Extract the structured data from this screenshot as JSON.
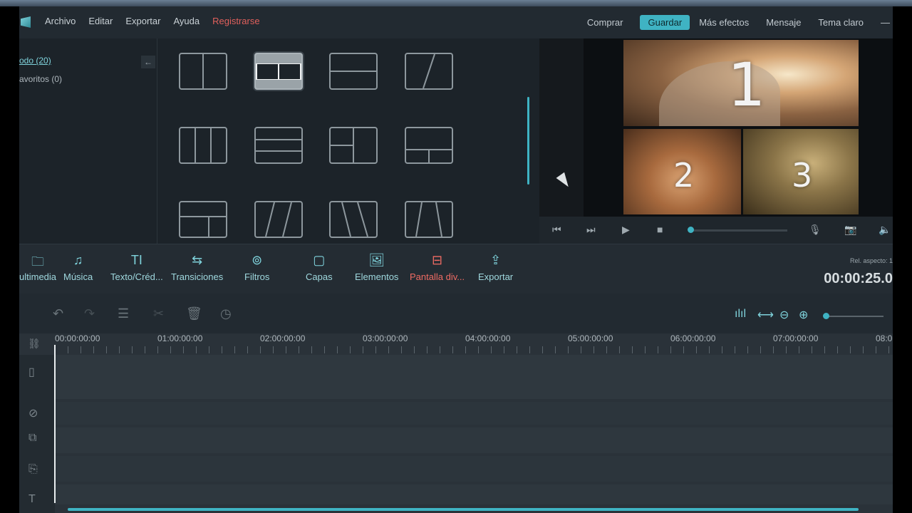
{
  "menu": {
    "left": [
      "Archivo",
      "Editar",
      "Exportar",
      "Ayuda"
    ],
    "register": "Registrarse",
    "right": [
      "Comprar",
      "Guardar",
      "Más efectos",
      "Mensaje",
      "Tema claro"
    ],
    "minimize": "—"
  },
  "library": {
    "categories": [
      "odo (20)",
      "avoritos (0)"
    ],
    "collapse_icon": "←"
  },
  "preview": {
    "labels": [
      "1",
      "2",
      "3"
    ]
  },
  "toolbar": {
    "items": [
      "ultimedia",
      "Música",
      "Texto/Créd...",
      "Transiciones",
      "Filtros",
      "Capas",
      "Elementos",
      "Pantalla div...",
      "Exportar"
    ],
    "aspect": "Rel. aspecto: 1",
    "timecode": "00:00:25.0"
  },
  "timeline": {
    "ticks": [
      "00:00:00:00",
      "01:00:00:00",
      "02:00:00:00",
      "03:00:00:00",
      "04:00:00:00",
      "05:00:00:00",
      "06:00:00:00",
      "07:00:00:00",
      "08:0"
    ]
  },
  "colors": {
    "accent": "#3fb3c3",
    "active": "#ef6b63",
    "register": "#e0605c"
  }
}
